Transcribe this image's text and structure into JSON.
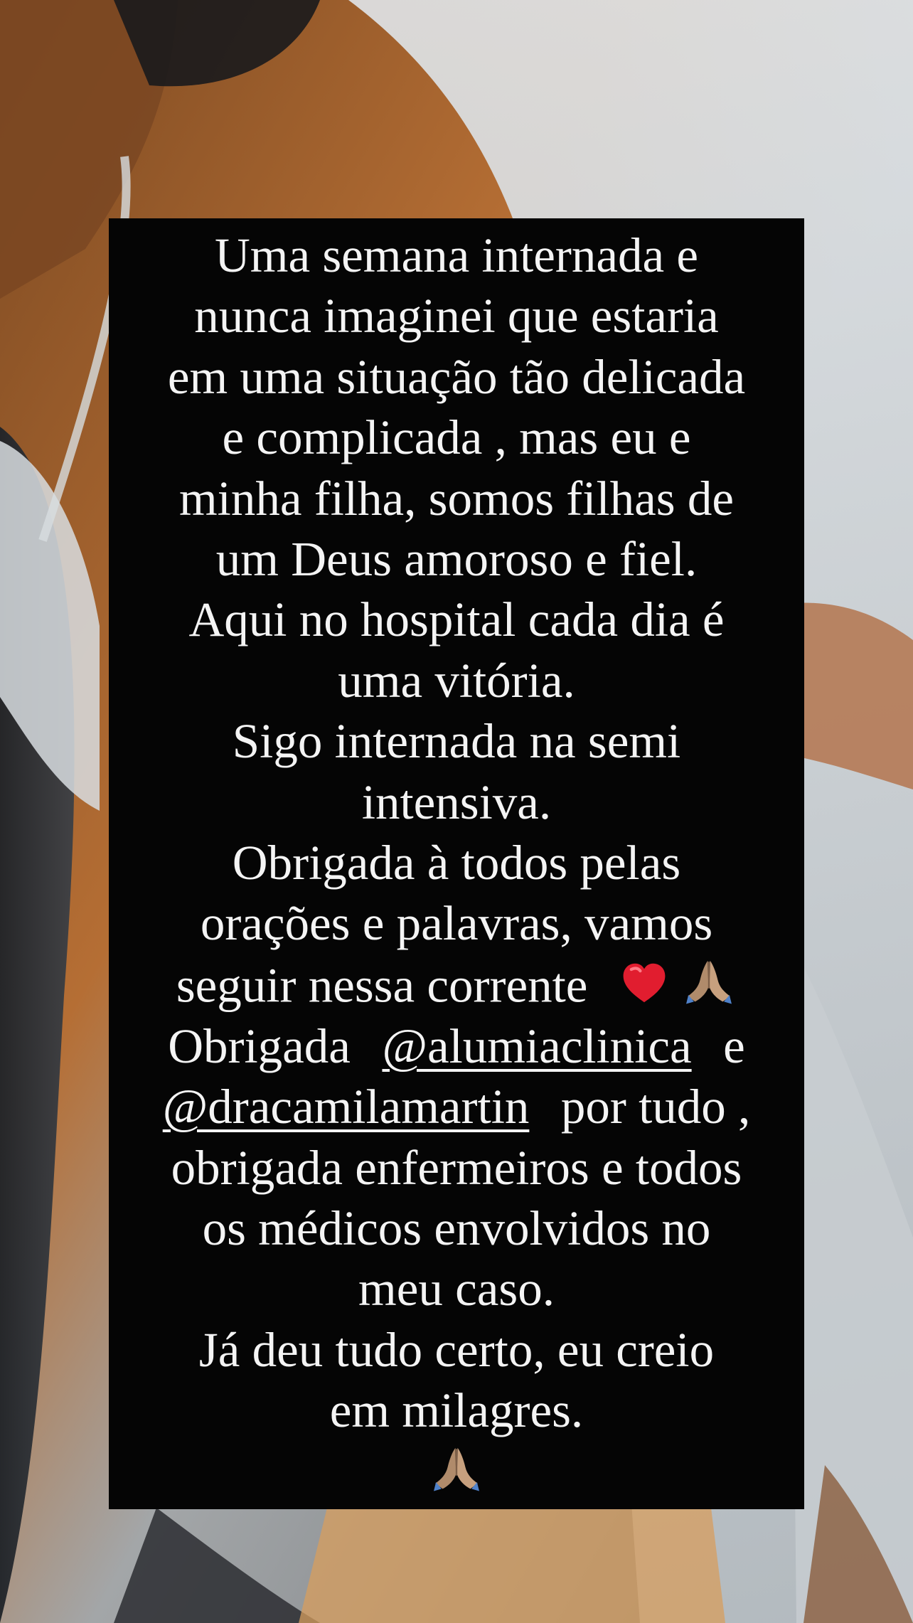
{
  "story": {
    "lines": {
      "l1": "Uma semana internada e",
      "l2": "nunca imaginei que estaria",
      "l3": "em uma situação tão delicada",
      "l4": "e complicada , mas eu e",
      "l5": "minha filha, somos filhas de",
      "l6": "um Deus amoroso e fiel.",
      "l7": "Aqui no hospital cada dia é",
      "l8": "uma vitória.",
      "l9": "Sigo internada na semi",
      "l10": "intensiva.",
      "l11": "Obrigada à todos pelas",
      "l12": "orações e palavras, vamos",
      "l13_text": "seguir nessa corrente",
      "l14_before": "Obrigada",
      "l14_after": "e",
      "l15_after": "por tudo ,",
      "l16": "obrigada enfermeiros e todos",
      "l17": "os médicos envolvidos no",
      "l18": "meu caso.",
      "l19": "Já deu tudo certo, eu creio",
      "l20": "em milagres."
    },
    "mentions": {
      "alumiaclinica": "@alumiaclinica",
      "dracamilamartin": "@dracamilamartin"
    },
    "emojis": {
      "heart": "red-heart-icon",
      "pray": "praying-hands-icon"
    }
  },
  "colors": {
    "card_background": "#050505",
    "text": "#f4f4f4"
  }
}
